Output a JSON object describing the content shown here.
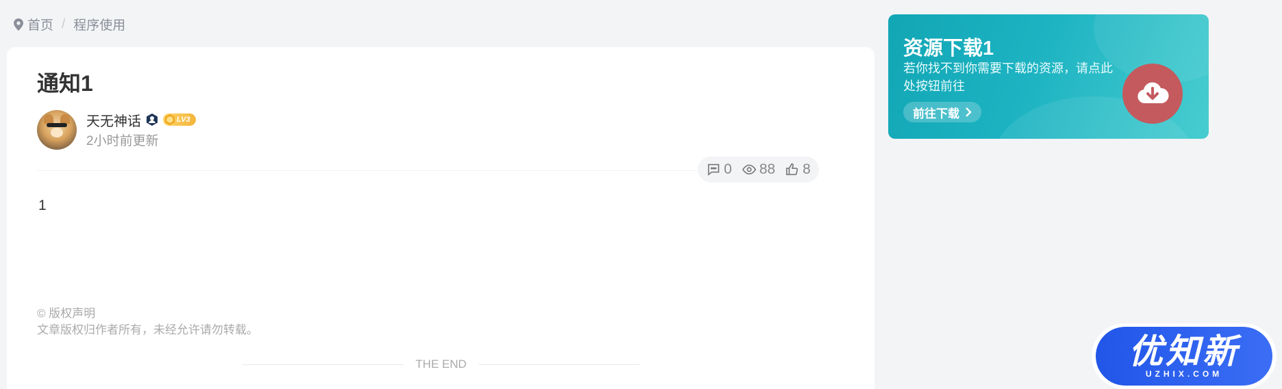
{
  "breadcrumb": {
    "home": "首页",
    "current": "程序使用"
  },
  "post": {
    "title": "通知1",
    "author": {
      "name": "天无神话",
      "level": "LV3",
      "updated": "2小时前更新"
    },
    "stats": {
      "comments": "0",
      "views": "88",
      "likes": "8"
    },
    "content": "1",
    "copyright": {
      "heading": "© 版权声明",
      "text": "文章版权归作者所有，未经允许请勿转载。"
    },
    "end_label": "THE END"
  },
  "banner": {
    "title": "资源下载1",
    "description": "若你找不到你需要下载的资源，请点此处按钮前往",
    "button": "前往下载",
    "colors": {
      "start": "#12a6b5",
      "end": "#47cdd0",
      "icon_bg": "#c45a5e"
    }
  },
  "watermark": {
    "main": "优知新",
    "sub": "UZHIX.COM",
    "color": "#2156e8"
  }
}
